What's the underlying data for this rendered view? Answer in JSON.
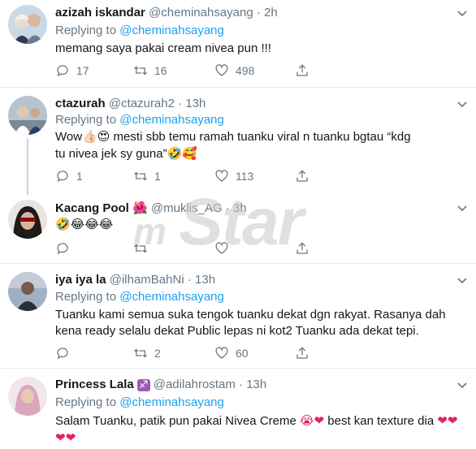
{
  "tweets": [
    {
      "name": "azizah iskandar",
      "handle": "@cheminahsayang",
      "dot": "·",
      "time": "2h",
      "replying_prefix": "Replying to ",
      "replying_to": "@cheminahsayang",
      "text": "memang saya pakai cream nivea pun !!!",
      "replies": "17",
      "retweets": "16",
      "likes": "498"
    },
    {
      "name": "ctazurah",
      "handle": "@ctazurah2",
      "dot": "·",
      "time": "13h",
      "replying_prefix": "Replying to ",
      "replying_to": "@cheminahsayang",
      "text_part1": "Wow",
      "text_emoji1": "👍🏻😍",
      "text_part2": " mesti sbb temu ramah tuanku viral n tuanku bgtau “kdg tu nivea jek sy guna”",
      "text_emoji2": "🤣🥰",
      "replies": "1",
      "retweets": "1",
      "likes": "113"
    },
    {
      "name": "Kacang Pool",
      "name_emoji": "🌺",
      "handle": "@muklis_AG",
      "dot": "·",
      "time": "3h",
      "text_emoji": "🤣😂😂😂",
      "replies": "",
      "retweets": "",
      "likes": ""
    },
    {
      "name": "iya iya la",
      "handle": "@ilhamBahNi",
      "dot": "·",
      "time": "13h",
      "replying_prefix": "Replying to ",
      "replying_to": "@cheminahsayang",
      "text": "Tuanku kami semua suka tengok tuanku dekat dgn rakyat. Rasanya dah kena ready selalu dekat Public lepas ni kot2 Tuanku ada dekat tepi.",
      "replies": "",
      "retweets": "2",
      "likes": "60"
    },
    {
      "name": "Princess Lala",
      "name_emoji": "♐",
      "handle": "@adilahrostam",
      "dot": "·",
      "time": "13h",
      "replying_prefix": "Replying to ",
      "replying_to": "@cheminahsayang",
      "text_part1": "Salam Tuanku, patik pun pakai Nivea Creme ",
      "text_emoji1": "😭❤",
      "text_part2": " best kan texture dia ",
      "text_emoji2": "❤❤❤❤"
    }
  ],
  "watermark": {
    "prefix": "m",
    "brand": "Star"
  },
  "colors": {
    "link": "#1da1f2",
    "secondary": "#657786",
    "heart": "#e0245e"
  }
}
